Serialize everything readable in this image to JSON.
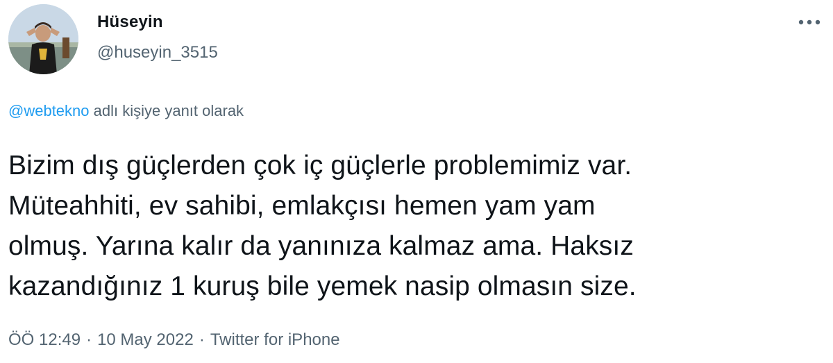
{
  "author": {
    "display_name": "Hüseyin",
    "handle": "@huseyin_3515"
  },
  "reply_context": {
    "mention": "@webtekno",
    "suffix": " adlı kişiye yanıt olarak"
  },
  "tweet": {
    "lines": [
      "Bizim dış güçlerden çok iç güçlerle problemimiz var.",
      "Müteahhiti, ev sahibi, emlakçısı hemen yam yam",
      "olmuş. Yarına kalır da yanınıza kalmaz ama. Haksız",
      "kazandığınız 1 kuruş bile yemek nasip olmasın size."
    ]
  },
  "meta": {
    "time": "ÖÖ 12:49",
    "date": "10 May 2022",
    "source": "Twitter for iPhone",
    "separator": "·"
  },
  "icons": {
    "more": "more-horizontal-icon",
    "avatar": "profile-photo"
  },
  "colors": {
    "text": "#0f1419",
    "secondary": "#536471",
    "link": "#1d9bf0"
  }
}
